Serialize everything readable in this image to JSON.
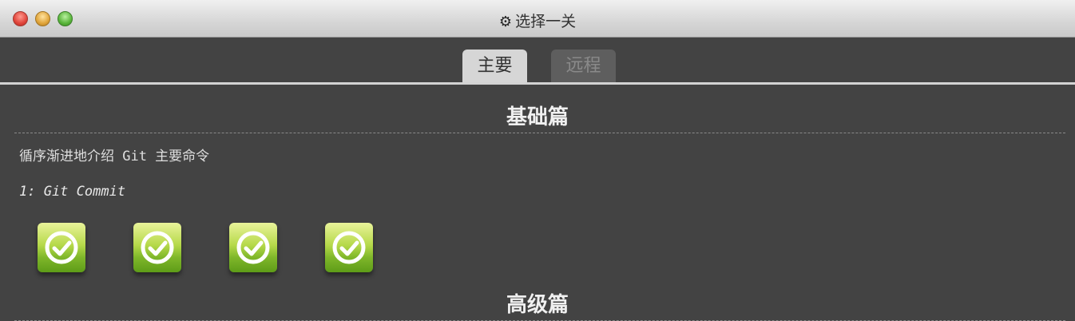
{
  "window": {
    "title": "选择一关",
    "title_icon": "gear-icon"
  },
  "tabs": [
    {
      "label": "主要",
      "active": true
    },
    {
      "label": "远程",
      "active": false
    }
  ],
  "sections": {
    "basic": {
      "title": "基础篇",
      "description": "循序渐进地介绍 Git 主要命令",
      "selected_level": "1: Git Commit",
      "levels": [
        {
          "completed": true,
          "icon": "check-circle-icon"
        },
        {
          "completed": true,
          "icon": "check-circle-icon"
        },
        {
          "completed": true,
          "icon": "check-circle-icon"
        },
        {
          "completed": true,
          "icon": "check-circle-icon"
        }
      ]
    },
    "advanced": {
      "title": "高级篇"
    }
  },
  "colors": {
    "background": "#434343",
    "tab_active": "#d6d6d6",
    "tab_inactive": "#5e5e5e",
    "level_complete": "#7fb72a"
  }
}
